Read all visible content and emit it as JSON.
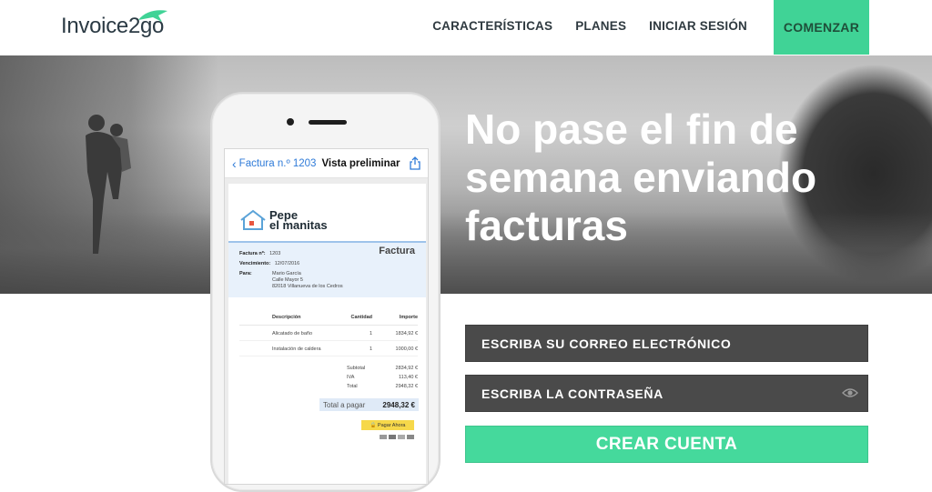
{
  "header": {
    "logo_text": "Invoice2go",
    "nav": [
      {
        "label": "CARACTERÍSTICAS"
      },
      {
        "label": "PLANES"
      },
      {
        "label": "INICIAR SESIÓN"
      }
    ],
    "cta_label": "COMENZAR"
  },
  "hero": {
    "title_line1": "No pase el fin de",
    "title_line2": "semana enviando",
    "title_line3": "facturas"
  },
  "phone": {
    "back_label": "Factura n.º 1203",
    "screen_title": "Vista preliminar",
    "invoice": {
      "brand_line1": "Pepe",
      "brand_line2": "el manitas",
      "doc_title": "Factura",
      "number_label": "Factura nº:",
      "number_value": "1203",
      "due_label": "Vencimiento:",
      "due_value": "12/07/2016",
      "to_label": "Para:",
      "client_name": "Mario García",
      "client_street": "Calle Mayor 5",
      "client_city": "82018 Villanueva de los Cedros",
      "columns": {
        "desc": "Descripción",
        "qty": "Cantidad",
        "amount": "Importe"
      },
      "items": [
        {
          "desc": "Alicatado de baño",
          "qty": "1",
          "amount": "1834,92 €"
        },
        {
          "desc": "Instalación de caldera",
          "qty": "1",
          "amount": "1000,00 €"
        }
      ],
      "subtotal_label": "Subtotal",
      "subtotal_value": "2834,92 €",
      "tax_label": "IVA",
      "tax_value": "113,40 €",
      "total_label": "Total",
      "total_value": "2948,32 €",
      "pay_total_label": "Total a pagar",
      "pay_total_value": "2948,32 €",
      "pay_button": "Pagar Ahora"
    }
  },
  "form": {
    "email_placeholder": "ESCRIBA SU CORREO ELECTRÓNICO",
    "password_placeholder": "ESCRIBA LA CONTRASEÑA",
    "submit_label": "CREAR CUENTA"
  },
  "colors": {
    "accent_green": "#45d99c",
    "field_bg": "#4a4a4a",
    "link_blue": "#2f7bd8"
  },
  "icons": [
    "logo-mark-icon",
    "eye-icon",
    "share-icon",
    "back-chevron-icon",
    "house-logo-icon",
    "lock-icon"
  ]
}
